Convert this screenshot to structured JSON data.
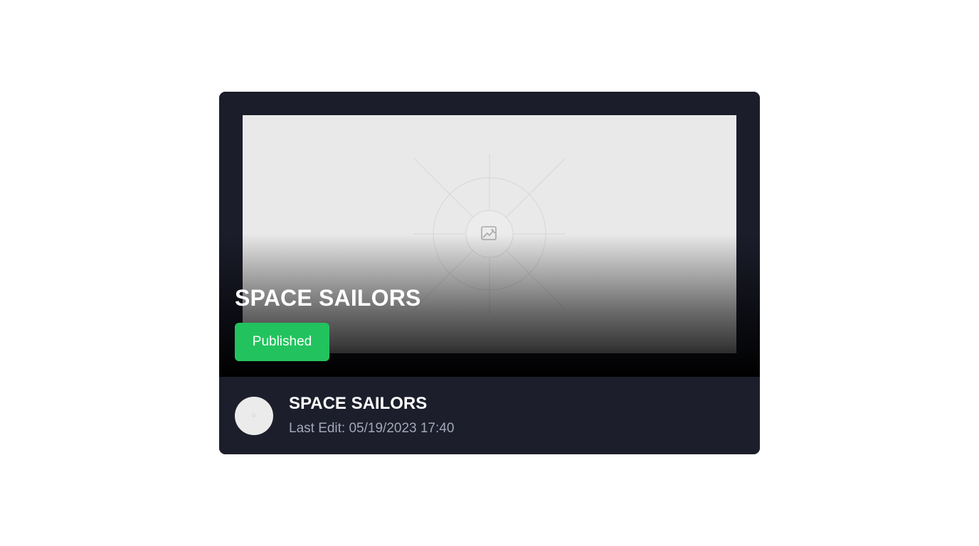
{
  "card": {
    "hero_title": "SPACE SAILORS",
    "status_label": "Published",
    "footer_title": "SPACE SAILORS",
    "last_edit_text": "Last Edit: 05/19/2023 17:40",
    "thumbnail_icon": "image-placeholder-icon"
  },
  "colors": {
    "card_background": "#1b1d2b",
    "status_badge": "#22c35e",
    "thumbnail_placeholder": "#e9e9e9",
    "meta_text": "#a3a8b6"
  }
}
